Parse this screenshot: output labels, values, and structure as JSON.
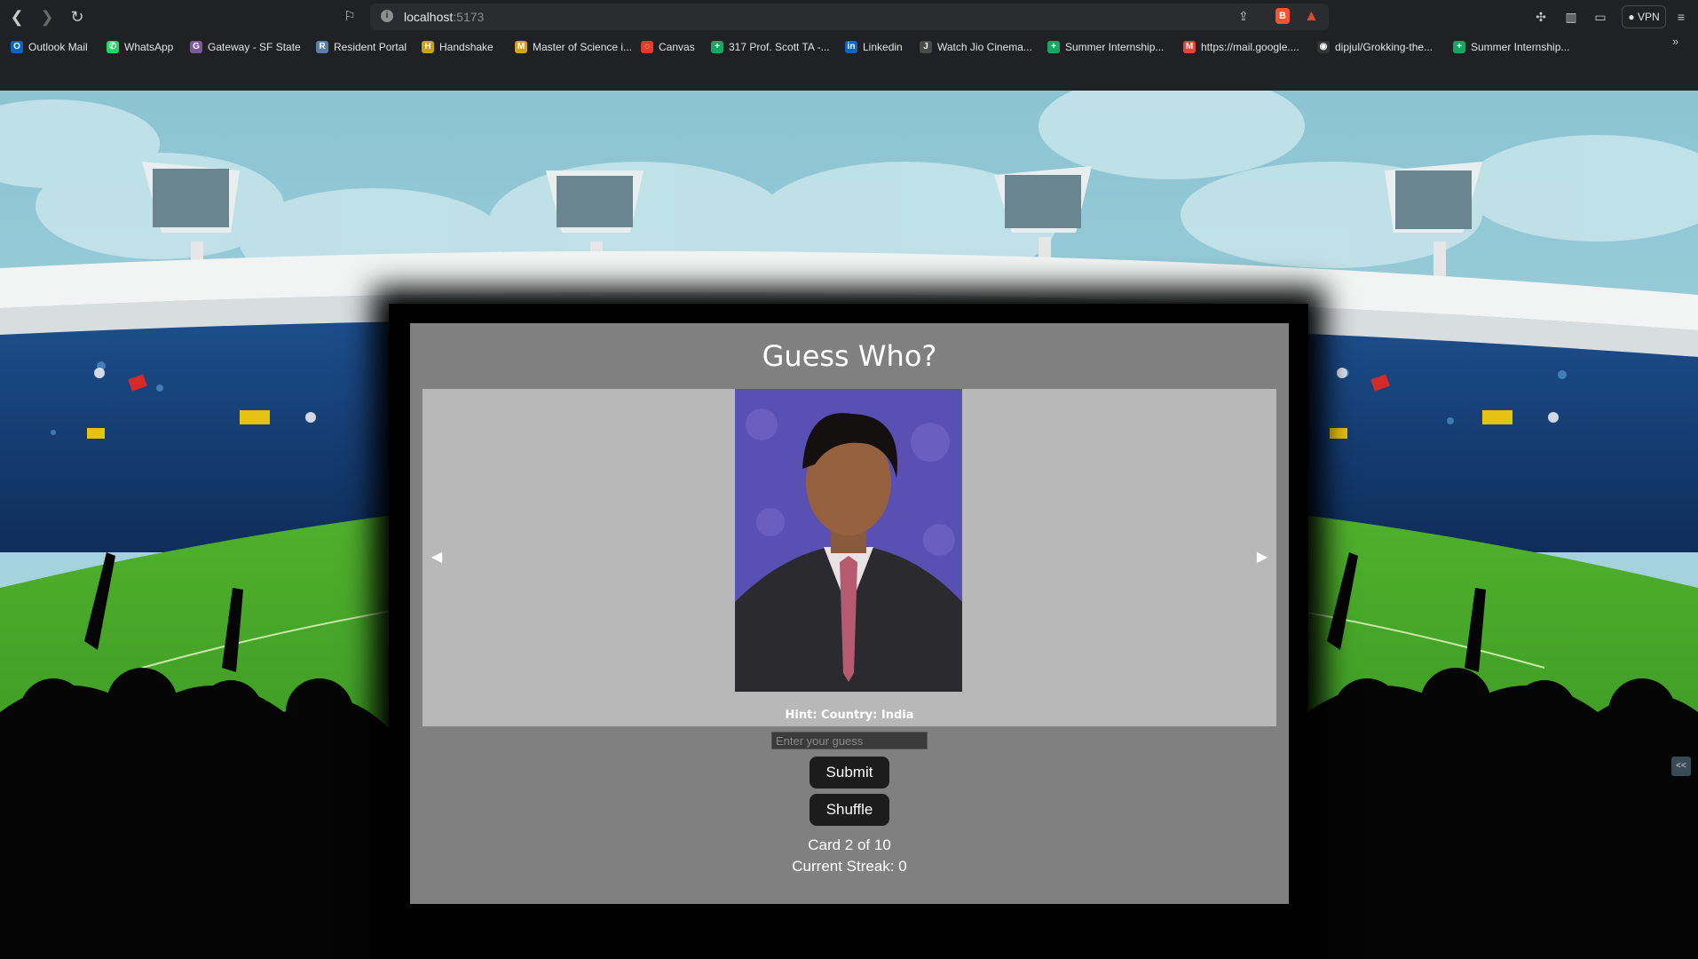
{
  "browser": {
    "url_host": "localhost",
    "url_port": ":5173",
    "vpn_label": "VPN",
    "bookmarks": [
      {
        "label": "Outlook Mail",
        "icon": "outlook-icon",
        "color": "#0a64c4",
        "glyph": "O"
      },
      {
        "label": "WhatsApp",
        "icon": "whatsapp-icon",
        "color": "#25d366",
        "glyph": "✆"
      },
      {
        "label": "Gateway - SF State",
        "icon": "gateway-icon",
        "color": "#7a5a9a",
        "glyph": "G"
      },
      {
        "label": "Resident Portal",
        "icon": "resident-portal-icon",
        "color": "#5a7fa8",
        "glyph": "R"
      },
      {
        "label": "Handshake",
        "icon": "handshake-icon",
        "color": "#c9a21a",
        "glyph": "H"
      },
      {
        "label": "Master of Science i...",
        "icon": "master-science-icon",
        "color": "#d6a21a",
        "glyph": "M"
      },
      {
        "label": "Canvas",
        "icon": "canvas-icon",
        "color": "#e13c2c",
        "glyph": "◌"
      },
      {
        "label": "317 Prof. Scott TA -...",
        "icon": "sheets-icon",
        "color": "#1ea362",
        "glyph": "+"
      },
      {
        "label": "Linkedin",
        "icon": "linkedin-icon",
        "color": "#0a66c2",
        "glyph": "in"
      },
      {
        "label": "Watch Jio Cinema...",
        "icon": "jiocinema-icon",
        "color": "#4a4a4a",
        "glyph": "J"
      },
      {
        "label": "Summer Internship...",
        "icon": "sheets-icon",
        "color": "#1ea362",
        "glyph": "+"
      },
      {
        "label": "https://mail.google....",
        "icon": "gmail-icon",
        "color": "#ea4335",
        "glyph": "M"
      },
      {
        "label": "dipjul/Grokking-the...",
        "icon": "github-icon",
        "color": "#333333",
        "glyph": "◉"
      },
      {
        "label": "Summer Internship...",
        "icon": "sheets-icon",
        "color": "#1ea362",
        "glyph": "+"
      }
    ]
  },
  "game": {
    "title": "Guess Who?",
    "hint": "Hint: Country: India",
    "guess_placeholder": "Enter your guess",
    "submit_label": "Submit",
    "shuffle_label": "Shuffle",
    "card_counter": "Card 2 of 10",
    "streak": "Current Streak: 0",
    "prev_arrow": "◀",
    "next_arrow": "▶"
  },
  "colors": {
    "card_bg": "#808080",
    "slide_bg": "#b8b8b8",
    "button_bg": "#1c1c1c",
    "sky": "#93c9d6",
    "grass": "#45a62a"
  }
}
